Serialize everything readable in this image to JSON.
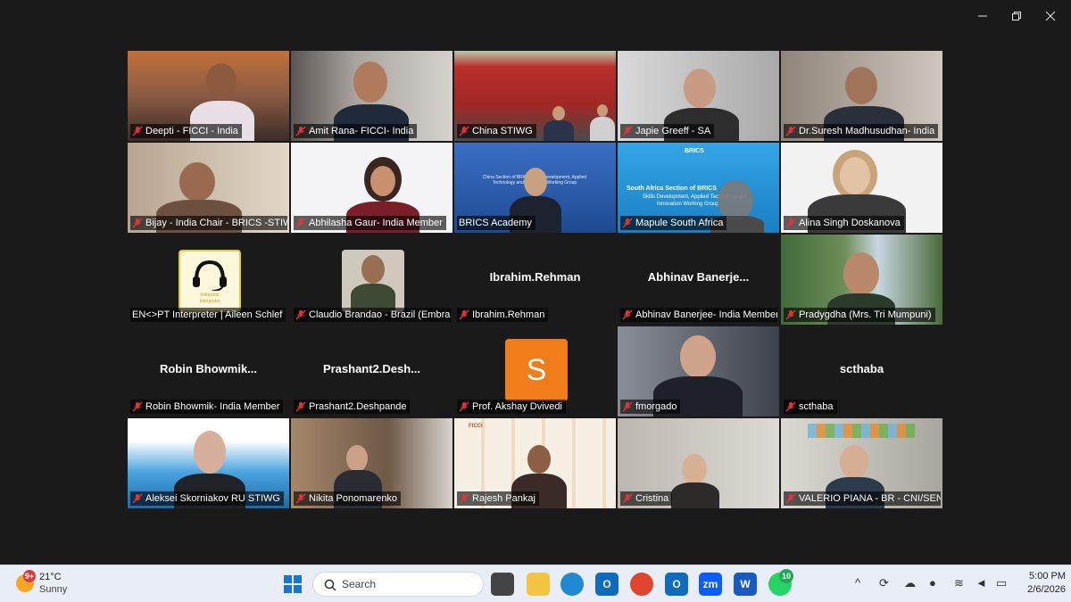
{
  "window": {
    "controls": [
      "minimize",
      "restore",
      "close"
    ]
  },
  "participants": [
    {
      "name": "Deepti - FICCI - India",
      "muted": true,
      "video": true
    },
    {
      "name": "Amit Rana- FICCI- India",
      "muted": true,
      "video": true
    },
    {
      "name": "China STIWG",
      "muted": true,
      "video": true
    },
    {
      "name": "Japie Greeff - SA",
      "muted": true,
      "video": true
    },
    {
      "name": "Dr.Suresh Madhusudhan- India",
      "muted": true,
      "video": true
    },
    {
      "name": "Bijay - India Chair - BRICS -STIWG",
      "muted": true,
      "video": true
    },
    {
      "name": "Abhilasha Gaur- India Member",
      "muted": true,
      "video": true
    },
    {
      "name": "BRICS Academy",
      "muted": false,
      "video": true,
      "active_speaker": true
    },
    {
      "name": "Mapule South Africa",
      "muted": true,
      "video": true
    },
    {
      "name": "Alina Singh Doskanova",
      "muted": true,
      "video": true
    },
    {
      "name": "EN<>PT Interpreter | Aileen Schlef",
      "muted": false,
      "video": false,
      "avatar": "headset"
    },
    {
      "name": "Claudio Brandao - Brazil (Embrapii)",
      "muted": true,
      "video": false,
      "avatar": "photo"
    },
    {
      "name": "Ibrahim.Rehman",
      "muted": true,
      "video": false,
      "display_name": "Ibrahim.Rehman"
    },
    {
      "name": "Abhinav Banerjee- India Member",
      "muted": true,
      "video": false,
      "display_name": "Abhinav  Banerje..."
    },
    {
      "name": "Pradygdha (Mrs. Tri Mumpuni)",
      "muted": true,
      "video": true
    },
    {
      "name": "Robin Bhowmik- India Member",
      "muted": true,
      "video": false,
      "display_name": "Robin  Bhowmik..."
    },
    {
      "name": "Prashant2.Deshpande",
      "muted": true,
      "video": false,
      "display_name": "Prashant2.Desh..."
    },
    {
      "name": "Prof. Akshay Dvivedi",
      "muted": true,
      "video": false,
      "avatar": "S"
    },
    {
      "name": "fmorgado",
      "muted": true,
      "video": true
    },
    {
      "name": "scthaba",
      "muted": true,
      "video": false,
      "display_name": "scthaba"
    },
    {
      "name": "Aleksei Skorniakov RU STIWG",
      "muted": true,
      "video": true
    },
    {
      "name": "Nikita Ponomarenko",
      "muted": true,
      "video": true
    },
    {
      "name": "Rajesh Pankaj",
      "muted": true,
      "video": true
    },
    {
      "name": "Cristina",
      "muted": true,
      "video": true
    },
    {
      "name": "VALERIO PIANA - BR - CNI/SENAI",
      "muted": true,
      "video": true
    }
  ],
  "tile_text": {
    "headset_caption_1": "Intérprete",
    "headset_caption_2": "Interpreter",
    "china_banner": "China Section of BRICS Skills Development, Applied Technology and Innovation Working Group",
    "sa_banner_1": "South Africa Section of BRICS",
    "sa_banner_2": "Skills Development, Applied Technology and",
    "sa_banner_3": "Innovation Working Group",
    "brics_logo": "BRICS",
    "ficci_logo": "FICCI"
  },
  "taskbar": {
    "weather_temp": "21°C",
    "weather_desc": "Sunny",
    "weather_badge": "9+",
    "search_placeholder": "Search",
    "whatsapp_badge": "10",
    "time": "5:00 PM",
    "date": "2/6/2026"
  },
  "colors": {
    "background": "#1a1a1a",
    "active_border": "#2fd36a",
    "muted_icon": "#e0333a",
    "avatar_orange": "#f07c1a",
    "taskbar": "#e9eef6"
  }
}
